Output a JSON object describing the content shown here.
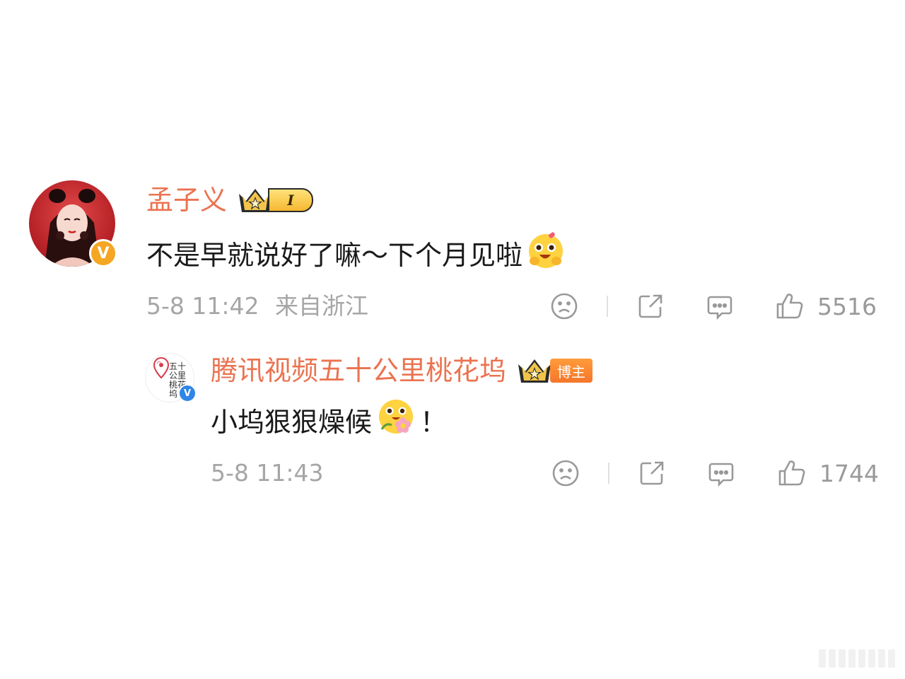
{
  "comment": {
    "username": "孟子义",
    "level_badge": "I",
    "text": "不是早就说好了嘛～下个月见啦",
    "emoji": "hug-face-emoji",
    "timestamp": "5-8 11:42",
    "location": "来自浙江",
    "like_count": "5516"
  },
  "reply": {
    "username": "腾讯视频五十公里桃花坞",
    "role_tag": "博主",
    "avatar_logo_text": "五十公里桃花坞",
    "text": "小坞狠狠燥候",
    "emoji": "flower-face-emoji",
    "text_suffix": "！",
    "timestamp": "5-8 11:43",
    "like_count": "1744"
  },
  "colors": {
    "username": "#eb7350",
    "text": "#1a1a1a",
    "meta": "#a6a6a6",
    "verified_orange": "#f5a623",
    "verified_blue": "#2f86e6",
    "blogger_tag": "#f4762a"
  },
  "icons": [
    "dislike-icon",
    "repost-icon",
    "comment-icon",
    "like-icon",
    "crown-icon",
    "verified-icon"
  ]
}
